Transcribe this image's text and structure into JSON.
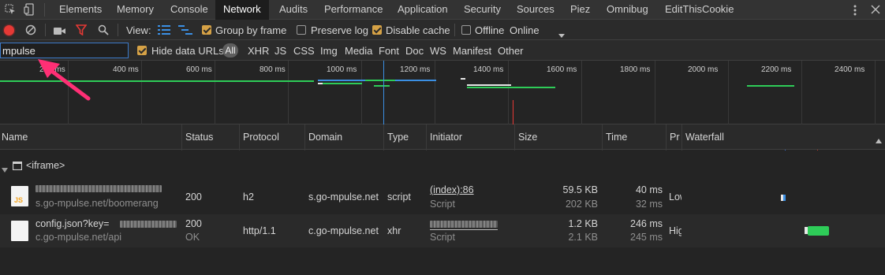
{
  "tabs": [
    "Elements",
    "Memory",
    "Console",
    "Network",
    "Audits",
    "Performance",
    "Application",
    "Security",
    "Sources",
    "Piez",
    "Omnibug",
    "EditThisCookie"
  ],
  "toolbar": {
    "view_label": "View:",
    "group_by_frame": "Group by frame",
    "preserve_log": "Preserve log",
    "disable_cache": "Disable cache",
    "offline": "Offline",
    "throttle": "Online",
    "checks": {
      "group_by_frame": true,
      "preserve_log": false,
      "disable_cache": true,
      "offline": false
    }
  },
  "filter": {
    "value": "mpulse",
    "hide_data_urls": "Hide data URLs",
    "hide_data_urls_checked": true,
    "types": [
      "All",
      "XHR",
      "JS",
      "CSS",
      "Img",
      "Media",
      "Font",
      "Doc",
      "WS",
      "Manifest",
      "Other"
    ],
    "active_type": "All"
  },
  "timeline": {
    "ticks": [
      "200 ms",
      "400 ms",
      "600 ms",
      "800 ms",
      "1000 ms",
      "1200 ms",
      "1400 ms",
      "1600 ms",
      "1800 ms",
      "2000 ms",
      "2200 ms",
      "2400 ms"
    ]
  },
  "columns": [
    "Name",
    "Status",
    "Protocol",
    "Domain",
    "Type",
    "Initiator",
    "Size",
    "Time",
    "Pr",
    "Waterfall"
  ],
  "group": {
    "label": "<iframe>"
  },
  "rows": [
    {
      "icon": "js-file-icon",
      "icon_text": "JS",
      "name_sub": "s.go-mpulse.net/boomerang",
      "status": "200",
      "status_sub": "",
      "protocol": "h2",
      "domain": "s.go-mpulse.net",
      "type": "script",
      "initiator": "(index):86",
      "initiator_sub": "Script",
      "size": "59.5 KB",
      "size_sub": "202 KB",
      "time": "40 ms",
      "time_sub": "32 ms",
      "priority": "Low"
    },
    {
      "icon": "document-icon",
      "name": "config.json?key=",
      "name_sub": "c.go-mpulse.net/api",
      "status": "200",
      "status_sub": "OK",
      "protocol": "http/1.1",
      "domain": "c.go-mpulse.net",
      "type": "xhr",
      "initiator_sub": "Script",
      "size": "1.2 KB",
      "size_sub": "2.1 KB",
      "time": "246 ms",
      "time_sub": "245 ms",
      "priority": "High"
    }
  ],
  "colors": {
    "accent_red": "#e53935",
    "check_orange": "#d6a246",
    "blue_icon": "#3b8fe3",
    "arrow_pink": "#ff2f75"
  }
}
